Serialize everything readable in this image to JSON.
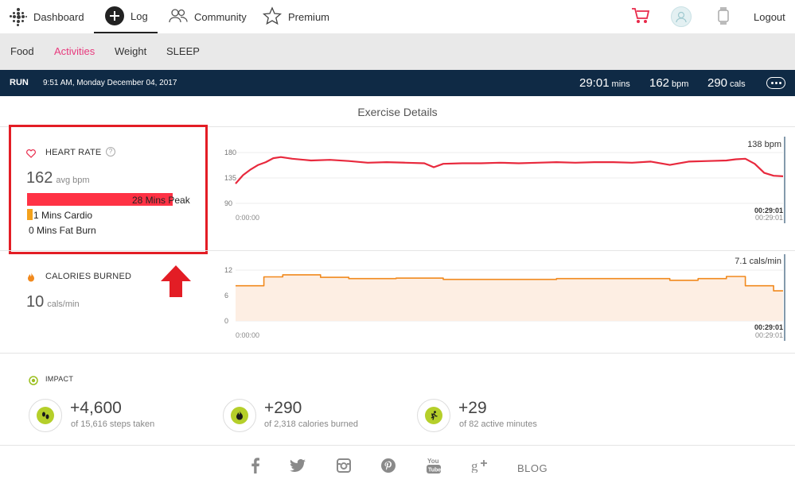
{
  "nav": {
    "dashboard": "Dashboard",
    "log": "Log",
    "community": "Community",
    "premium": "Premium",
    "logout": "Logout"
  },
  "subnav": {
    "food": "Food",
    "activities": "Activities",
    "weight": "Weight",
    "sleep": "SLEEP"
  },
  "activity": {
    "type": "RUN",
    "datetime": "9:51 AM, Monday December 04, 2017",
    "duration": "29:01",
    "duration_unit": "mins",
    "bpm": "162",
    "bpm_unit": "bpm",
    "cals": "290",
    "cals_unit": "cals"
  },
  "section_title": "Exercise Details",
  "heart_rate": {
    "label": "HEART RATE",
    "help": "?",
    "avg": "162",
    "avg_unit": "avg bpm",
    "peak": "28 Mins Peak",
    "cardio": "1 Mins Cardio",
    "fatburn": "0 Mins Fat Burn",
    "zones": {
      "peak_minutes": 28,
      "cardio_minutes": 1,
      "fatburn_minutes": 0,
      "total_minutes": 29
    }
  },
  "calories": {
    "label": "CALORIES BURNED",
    "avg": "10",
    "avg_unit": "cals/min"
  },
  "chart_data": [
    {
      "type": "line",
      "ticks": [
        "180",
        "135",
        "90"
      ],
      "ylim": [
        90,
        190
      ],
      "x_start": "0:00:00",
      "x_end": "00:29:01",
      "x_end_dup": "00:29:01",
      "current_label": "138 bpm",
      "color": "#e8293d",
      "series": [
        {
          "x": [
            0,
            0.4,
            0.8,
            1.2,
            1.6,
            2.0,
            2.4,
            3.0,
            4.0,
            5.0,
            6.0,
            7.0,
            8.0,
            9.0,
            10.0,
            10.5,
            11.0,
            12.0,
            13.0,
            14.0,
            15.0,
            16.0,
            17.0,
            18.0,
            19.0,
            20.0,
            21.0,
            22.0,
            23.0,
            24.0,
            25.0,
            26.0,
            26.5,
            27.0,
            27.5,
            28.0,
            28.5,
            29.0
          ],
          "y": [
            125,
            140,
            150,
            158,
            163,
            170,
            172,
            169,
            166,
            167,
            165,
            162,
            163,
            162,
            161,
            154,
            160,
            161,
            161,
            162,
            161,
            162,
            163,
            162,
            163,
            163,
            162,
            164,
            158,
            164,
            165,
            166,
            168,
            169,
            160,
            144,
            139,
            138
          ]
        }
      ]
    },
    {
      "type": "area",
      "ticks": [
        "12",
        "6",
        "0"
      ],
      "ylim": [
        0,
        12
      ],
      "x_start": "0:00:00",
      "x_end": "00:29:01",
      "x_end_dup": "00:29:01",
      "current_label": "7.1 cals/min",
      "color": "#f1891d",
      "fill": "#fdeee3",
      "series": [
        {
          "x": [
            0,
            1.5,
            1.5,
            2.5,
            2.5,
            4.5,
            4.5,
            6.0,
            6.0,
            8.5,
            8.5,
            11.0,
            11.0,
            17.0,
            17.0,
            23.0,
            23.0,
            24.5,
            24.5,
            26.0,
            26.0,
            27.0,
            27.0,
            28.5,
            28.5,
            29.0
          ],
          "y": [
            8.3,
            8.3,
            10.4,
            10.4,
            10.9,
            10.9,
            10.3,
            10.3,
            10.0,
            10.0,
            10.1,
            10.1,
            9.8,
            9.8,
            10.0,
            10.0,
            9.6,
            9.6,
            10.0,
            10.0,
            10.5,
            10.5,
            8.3,
            8.3,
            7.1,
            7.1
          ]
        }
      ]
    }
  ],
  "impact": {
    "title": "IMPACT",
    "items": [
      {
        "value": "+4,600",
        "sub": "of 15,616 steps taken",
        "icon": "footsteps-icon"
      },
      {
        "value": "+290",
        "sub": "of 2,318 calories burned",
        "icon": "flame-icon"
      },
      {
        "value": "+29",
        "sub": "of 82 active minutes",
        "icon": "runner-icon"
      }
    ]
  },
  "footer": {
    "blog": "BLOG"
  },
  "colors": {
    "accent": "#e83a7d",
    "header": "#0f2a45",
    "heart_peak": "#ff3245",
    "heart_cardio": "#f4a21c",
    "highlight_box": "#e31d25",
    "impact_icon": "#b5cf2a"
  }
}
